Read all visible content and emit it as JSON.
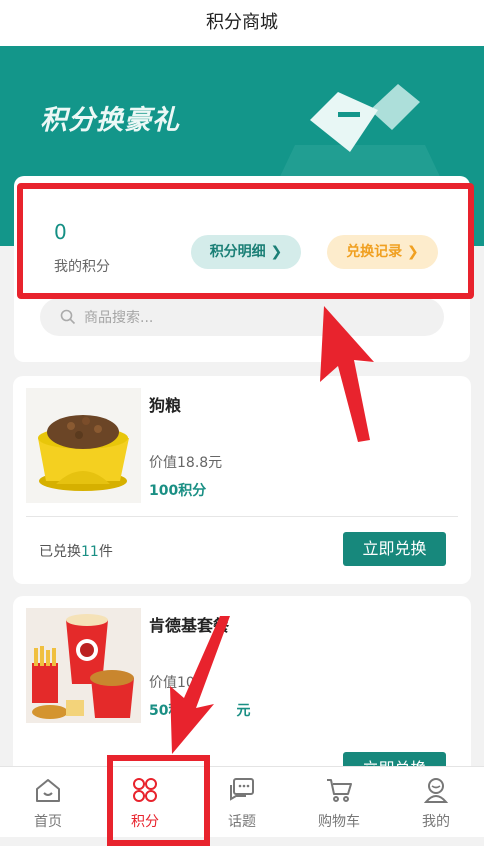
{
  "header": {
    "title": "积分商城"
  },
  "hero": {
    "title": "积分换豪礼"
  },
  "points": {
    "value": "0",
    "label": "我的积分",
    "detail_label": "积分明细 ❯",
    "record_label": "兑换记录 ❯"
  },
  "search": {
    "placeholder": "商品搜索..."
  },
  "products": [
    {
      "name": "狗粮",
      "price": "价值18.8元",
      "points": "100积分",
      "sold_prefix": "已兑换",
      "sold_count": "11",
      "sold_suffix": "件",
      "button": "立即兑换"
    },
    {
      "name": "肯德基套餐",
      "price": "价值10",
      "points": "50积",
      "points_tail": "元",
      "button": "立即兑换"
    }
  ],
  "tabbar": {
    "items": [
      {
        "label": "首页",
        "icon": "home-icon"
      },
      {
        "label": "积分",
        "icon": "points-grid-icon",
        "active": true
      },
      {
        "label": "话题",
        "icon": "chat-icon"
      },
      {
        "label": "购物车",
        "icon": "cart-icon"
      },
      {
        "label": "我的",
        "icon": "user-icon"
      }
    ]
  },
  "colors": {
    "brand": "#13968a",
    "accent_orange": "#f0a021",
    "annotation_red": "#e8232d"
  }
}
